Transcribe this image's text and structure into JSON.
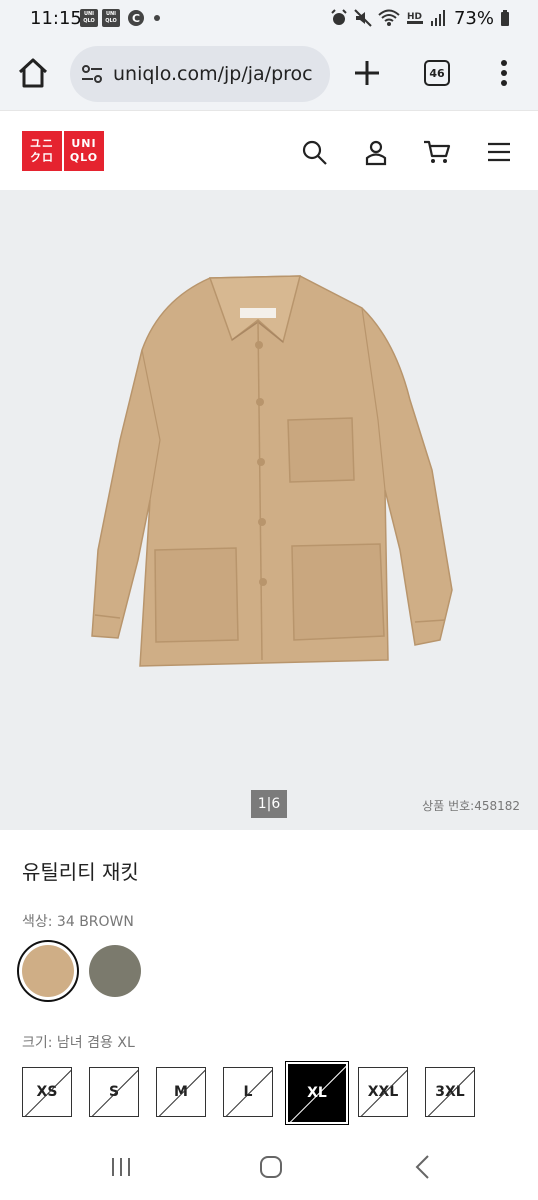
{
  "status_bar": {
    "time": "11:15",
    "app_badge_top": "UNI",
    "app_badge_bottom": "QLO",
    "c_badge": "C",
    "battery": "73%"
  },
  "browser": {
    "url": "uniqlo.com/jp/ja/proc",
    "tab_count": "46"
  },
  "header": {
    "logo_left_top": "ユニ",
    "logo_left_bottom": "クロ",
    "logo_right_top": "UNI",
    "logo_right_bottom": "QLO",
    "icons": [
      "search-icon",
      "account-icon",
      "cart-icon",
      "menu-icon"
    ]
  },
  "gallery": {
    "counter": "1|6",
    "product_number": "상품 번호:458182"
  },
  "product": {
    "title": "유틸리티 재킷",
    "color_label": "색상: 34 BROWN",
    "colors": [
      {
        "name": "brown",
        "hex": "#cfae86",
        "selected": true
      },
      {
        "name": "olive",
        "hex": "#7b7a6d",
        "selected": false
      }
    ],
    "size_label": "크기: 남녀 겸용 XL",
    "sizes": [
      {
        "label": "XS",
        "available": false,
        "selected": false
      },
      {
        "label": "S",
        "available": false,
        "selected": false
      },
      {
        "label": "M",
        "available": false,
        "selected": false
      },
      {
        "label": "L",
        "available": false,
        "selected": false
      },
      {
        "label": "XL",
        "available": false,
        "selected": true
      },
      {
        "label": "XXL",
        "available": false,
        "selected": false
      },
      {
        "label": "3XL",
        "available": false,
        "selected": false
      }
    ]
  },
  "colors": {
    "brand_red": "#e5232f",
    "image_bg": "#eceef0",
    "jacket": "#cfae86"
  }
}
